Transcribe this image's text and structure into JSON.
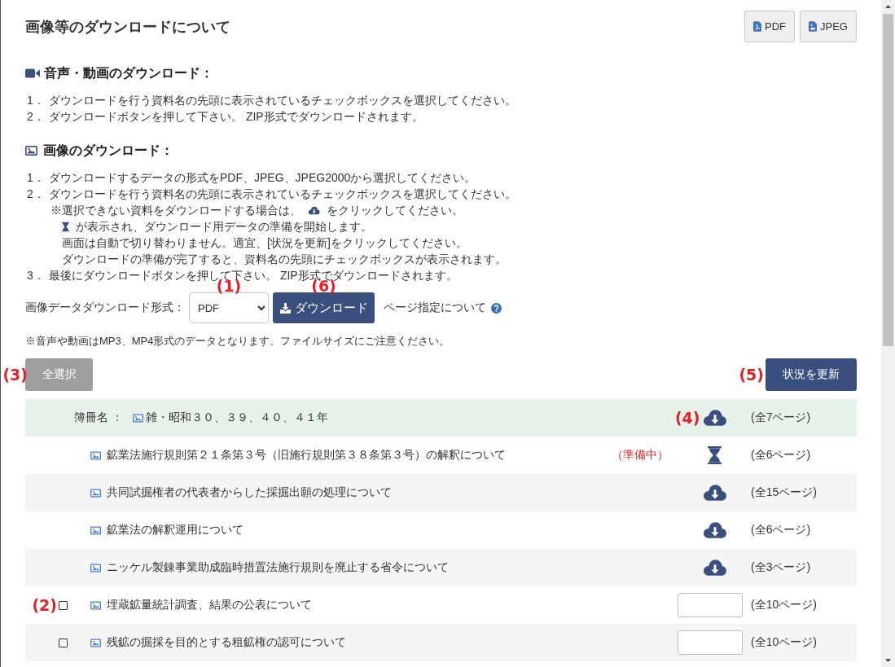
{
  "title": "画像等のダウンロードについて",
  "export_buttons": [
    {
      "kind": "pdf",
      "label": "PDF"
    },
    {
      "kind": "jpeg",
      "label": "JPEG"
    }
  ],
  "sections": [
    {
      "kind": "video",
      "heading": "音声・動画のダウンロード：",
      "steps": [
        {
          "number": "1．",
          "text": "ダウンロードを行う資料名の先頭に表示されているチェックボックスを選択してください。"
        },
        {
          "number": "2．",
          "text": "ダウンロードボタンを押して下さい。 ZIP形式でダウンロードされます。"
        }
      ]
    },
    {
      "kind": "image",
      "heading": "画像のダウンロード：",
      "steps": [
        {
          "number": "1．",
          "text": "ダウンロードするデータの形式をPDF、JPEG、JPEG2000から選択してください。"
        },
        {
          "number": "2．",
          "text": "ダウンロードを行う資料名の先頭に表示されているチェックボックスを選択してください。",
          "notes": [
            {
              "parts": [
                {
                  "kind": "text",
                  "text": "※選択できない資料をダウンロードする場合は、"
                },
                {
                  "kind": "download_icon"
                },
                {
                  "kind": "text",
                  "text": "をクリックしてください。"
                }
              ],
              "children": [
                {
                  "parts": [
                    {
                      "kind": "pending_icon"
                    },
                    {
                      "kind": "text",
                      "text": "が表示され、ダウンロード用データの準備を開始します。"
                    }
                  ]
                },
                {
                  "parts": [
                    {
                      "kind": "text",
                      "text": "画面は自動で切り替わりません。適宜、[状況を更新]をクリックしてください。"
                    }
                  ]
                },
                {
                  "parts": [
                    {
                      "kind": "text",
                      "text": "ダウンロードの準備が完了すると、資料名の先頭にチェックボックスが表示されます。"
                    }
                  ]
                }
              ]
            }
          ]
        },
        {
          "number": "3．",
          "text": "最後にダウンロードボタンを押して下さい。 ZIP形式でダウンロードされます。"
        }
      ]
    }
  ],
  "format_form": {
    "label": "画像データダウンロード形式：",
    "select": {
      "value": "PDF",
      "callout": "(1)"
    },
    "download_button": {
      "label": "ダウンロード",
      "callout": "(6)"
    },
    "help_link": "ページ指定について"
  },
  "media_note": "※音声や動画はMP3、MP4形式のデータとなります。ファイルサイズにご注意ください。",
  "select_all_button": {
    "label": "全選択",
    "callout": "(3)"
  },
  "refresh_button": {
    "label": "状況を更新",
    "callout": "(5)"
  },
  "volume": {
    "label": "簿冊名 ：",
    "name": "雑・昭和３０、３９、４０、４１年",
    "pages": "(全7ページ)",
    "callout": "(4)",
    "items": [
      {
        "kind": "preparing",
        "title": "鉱業法施行規則第２１条第３号（旧施行規則第３８条第３号）の解釈について",
        "status": "（準備中）",
        "pages": "(全6ページ)"
      },
      {
        "kind": "download",
        "title": "共同試掘権者の代表者からした採掘出願の処理について",
        "pages": "(全15ページ)"
      },
      {
        "kind": "download",
        "title": "鉱業法の解釈運用について",
        "pages": "(全6ページ)"
      },
      {
        "kind": "download",
        "title": "ニッケル製錬事業助成臨時措置法施行規則を廃止する省令について",
        "pages": "(全3ページ)"
      },
      {
        "kind": "ready",
        "title": "埋蔵鉱量統計調査、結果の公表について",
        "checked": false,
        "callout": "(2)",
        "pages": "(全10ページ)"
      },
      {
        "kind": "ready",
        "title": "残鉱の掘採を目的とする租鉱権の認可について",
        "checked": false,
        "pages": "(全10ページ)"
      }
    ]
  }
}
